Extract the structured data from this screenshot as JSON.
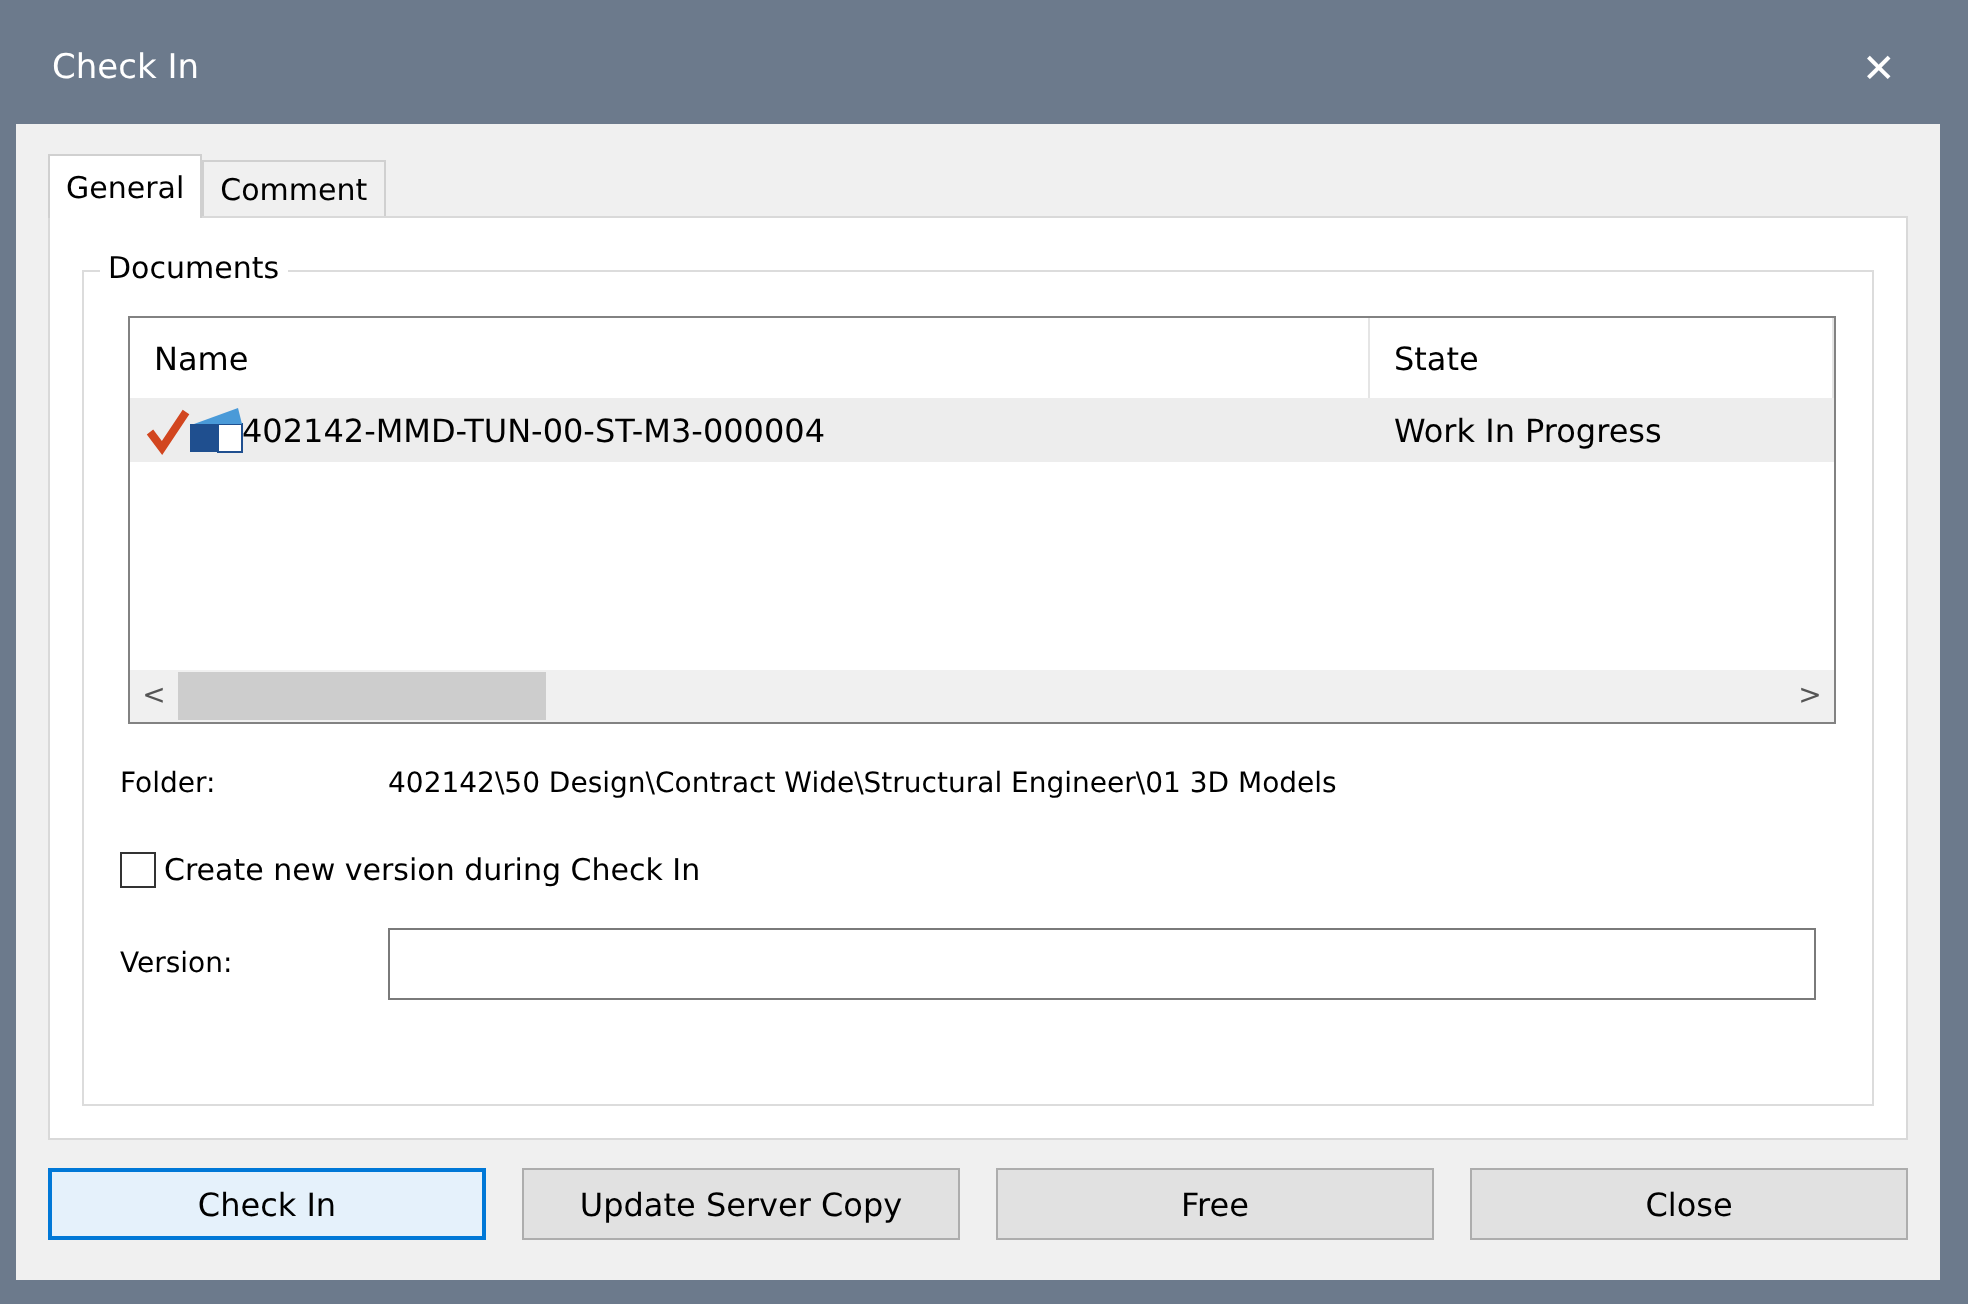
{
  "window": {
    "title": "Check In",
    "close": "✕"
  },
  "tabs": [
    {
      "label": "General",
      "selected": true
    },
    {
      "label": "Comment",
      "selected": false
    }
  ],
  "documents": {
    "title": "Documents",
    "columns": [
      "Name",
      "State"
    ],
    "rows": [
      {
        "name": "402142-MMD-TUN-00-ST-M3-000004",
        "state": "Work In Progress",
        "selected": true
      }
    ],
    "scroll_left": "<",
    "scroll_right": ">"
  },
  "folder": {
    "label": "Folder:",
    "value": "402142\\50 Design\\Contract Wide\\Structural Engineer\\01 3D Models"
  },
  "new_version": {
    "label": "Create new version during Check In",
    "checked": false
  },
  "version": {
    "label": "Version:"
  },
  "buttons": [
    {
      "label": "Check In",
      "focused": true
    },
    {
      "label": "Update Server Copy",
      "focused": false
    },
    {
      "label": "Free",
      "focused": false
    },
    {
      "label": "Close",
      "focused": false
    }
  ]
}
